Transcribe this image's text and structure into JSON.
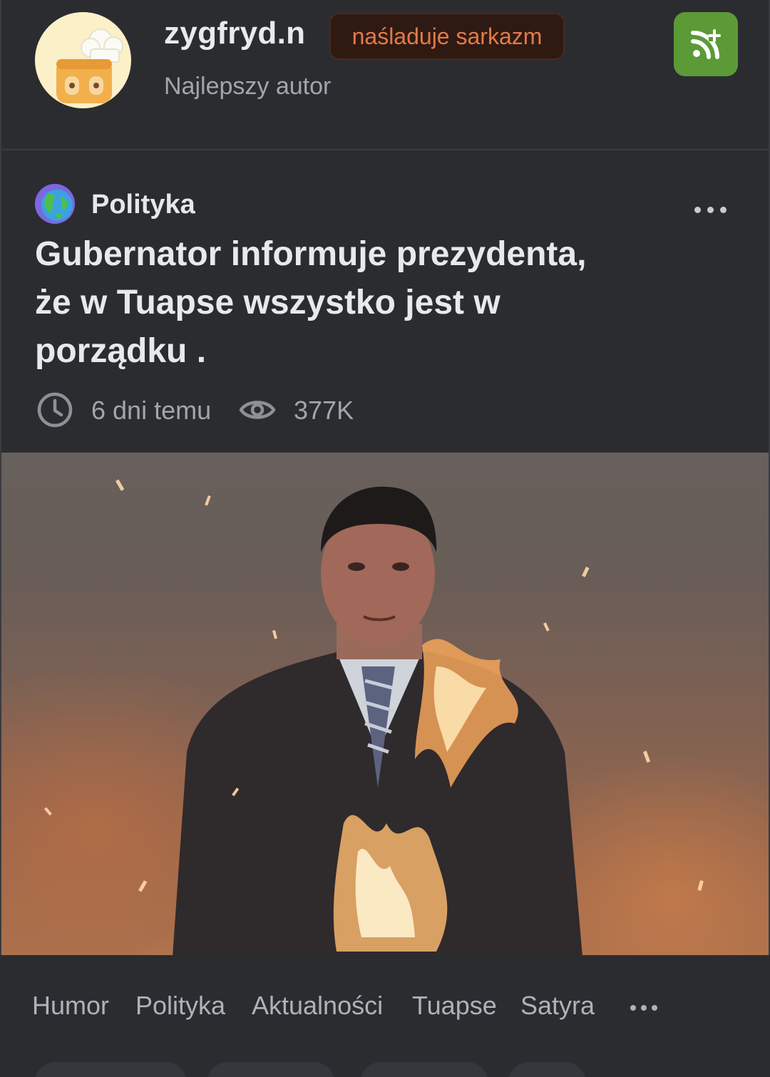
{
  "author": {
    "name": "zygfryd.n",
    "badge": "naśladuje sarkazm",
    "subtitle": "Najlepszy autor",
    "avatar_icon": "chef-toast-icon",
    "follow_icon": "rss-plus-icon",
    "follow_color": "#5b9a37"
  },
  "post": {
    "category": "Polityka",
    "category_icon": "globe-icon",
    "title_lines": [
      "Gubernator informuje prezydenta,",
      "że w Tuapse wszystko jest w",
      "porządku ."
    ],
    "time": "6 dni temu",
    "views": "377K",
    "image_description_icon": "burning-man-photo"
  },
  "tags": [
    "Humor",
    "Polityka",
    "Aktualności",
    "Tuapse",
    "Satyra"
  ],
  "colors": {
    "background": "#2a2b2f",
    "badge_text": "#e37a4a",
    "muted_text": "#a3a5ab"
  }
}
